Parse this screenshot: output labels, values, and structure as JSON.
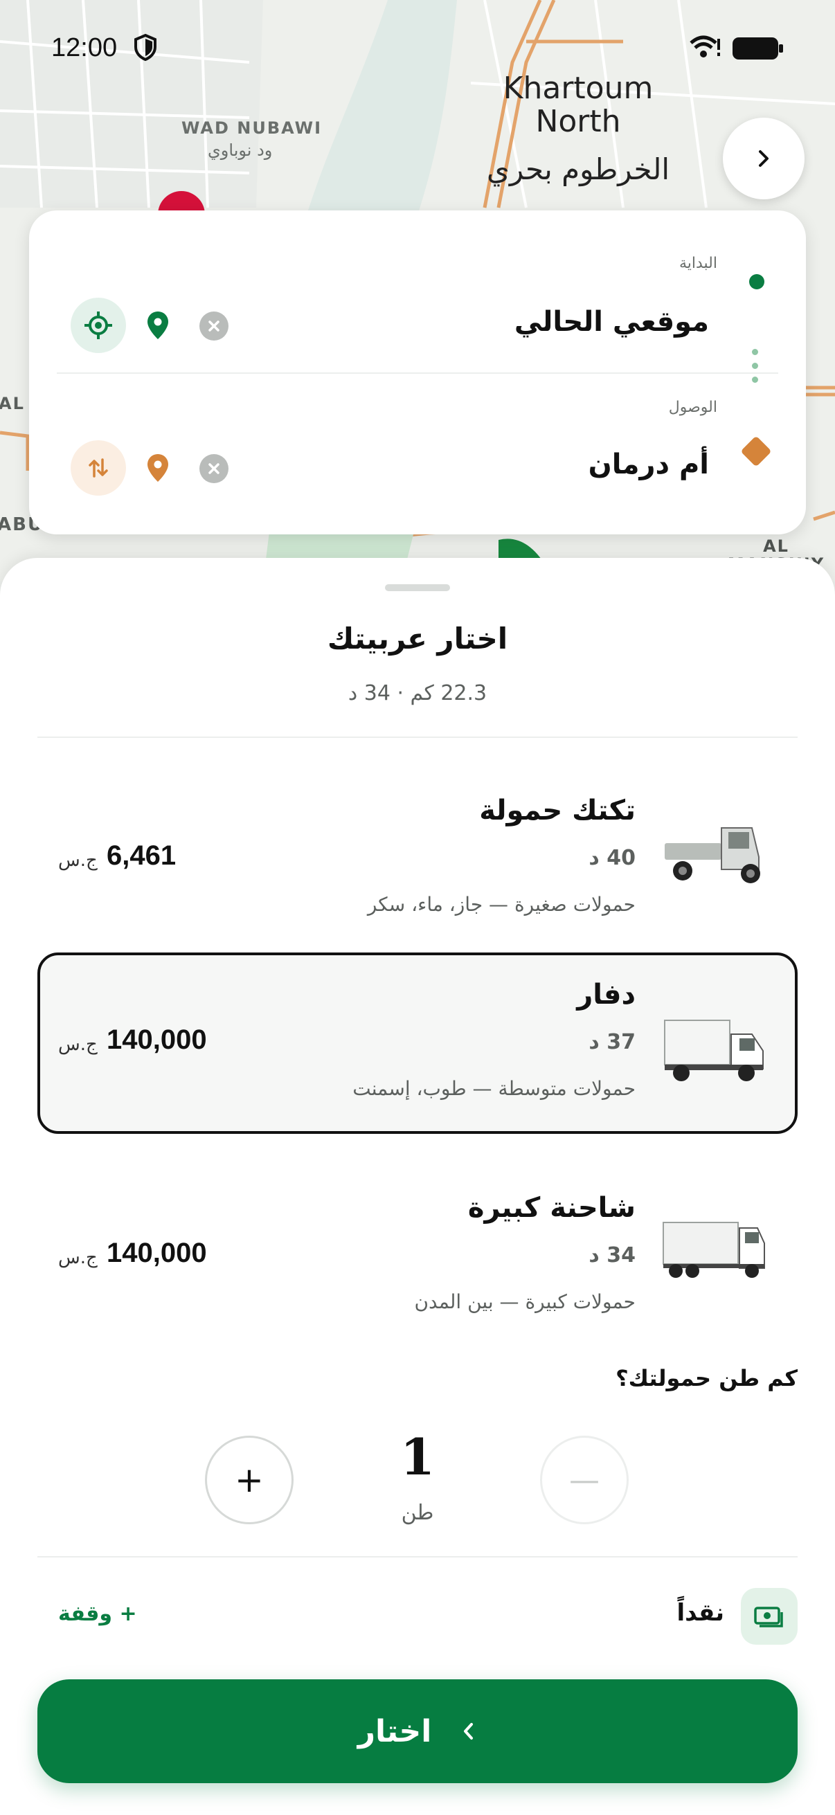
{
  "status_bar": {
    "time": "12:00"
  },
  "map": {
    "labels": {
      "khartoum_north_en": "Khartoum North",
      "khartoum_north_ar": "الخرطوم بحري",
      "wad_nubawi_en": "WAD NUBAWI",
      "wad_nubawi_ar": "ود نوباوي",
      "al_manshiy": "AL MANSHIY",
      "abu": "ABU",
      "al": "AL"
    }
  },
  "route": {
    "origin_label": "البداية",
    "origin_value": "موقعي الحالي",
    "destination_label": "الوصول",
    "destination_value": "أم درمان"
  },
  "sheet": {
    "title": "اختار عربيتك",
    "subtitle": "22.3 كم · 34 د"
  },
  "vehicles": [
    {
      "name": "تكتك حمولة",
      "time": "40 د",
      "description": "حمولات صغيرة — جاز، ماء، سكر",
      "price": "6,461",
      "currency": "ج.س",
      "selected": false
    },
    {
      "name": "دفار",
      "time": "37 د",
      "description": "حمولات متوسطة — طوب، إسمنت",
      "price": "140,000",
      "currency": "ج.س",
      "selected": true
    },
    {
      "name": "شاحنة كبيرة",
      "time": "34 د",
      "description": "حمولات كبيرة — بين المدن",
      "price": "140,000",
      "currency": "ج.س",
      "selected": false
    }
  ],
  "quantity": {
    "question": "كم طن حمولتك؟",
    "value": "1",
    "unit": "طن",
    "minus_symbol": "—",
    "plus_symbol": "+"
  },
  "payment": {
    "method": "نقداً",
    "add_stop": "+ وقفة"
  },
  "cta": {
    "label": "اختار"
  },
  "colors": {
    "brand_green": "#067d41",
    "destination_orange": "#d5843a",
    "selected_border": "#111111"
  }
}
